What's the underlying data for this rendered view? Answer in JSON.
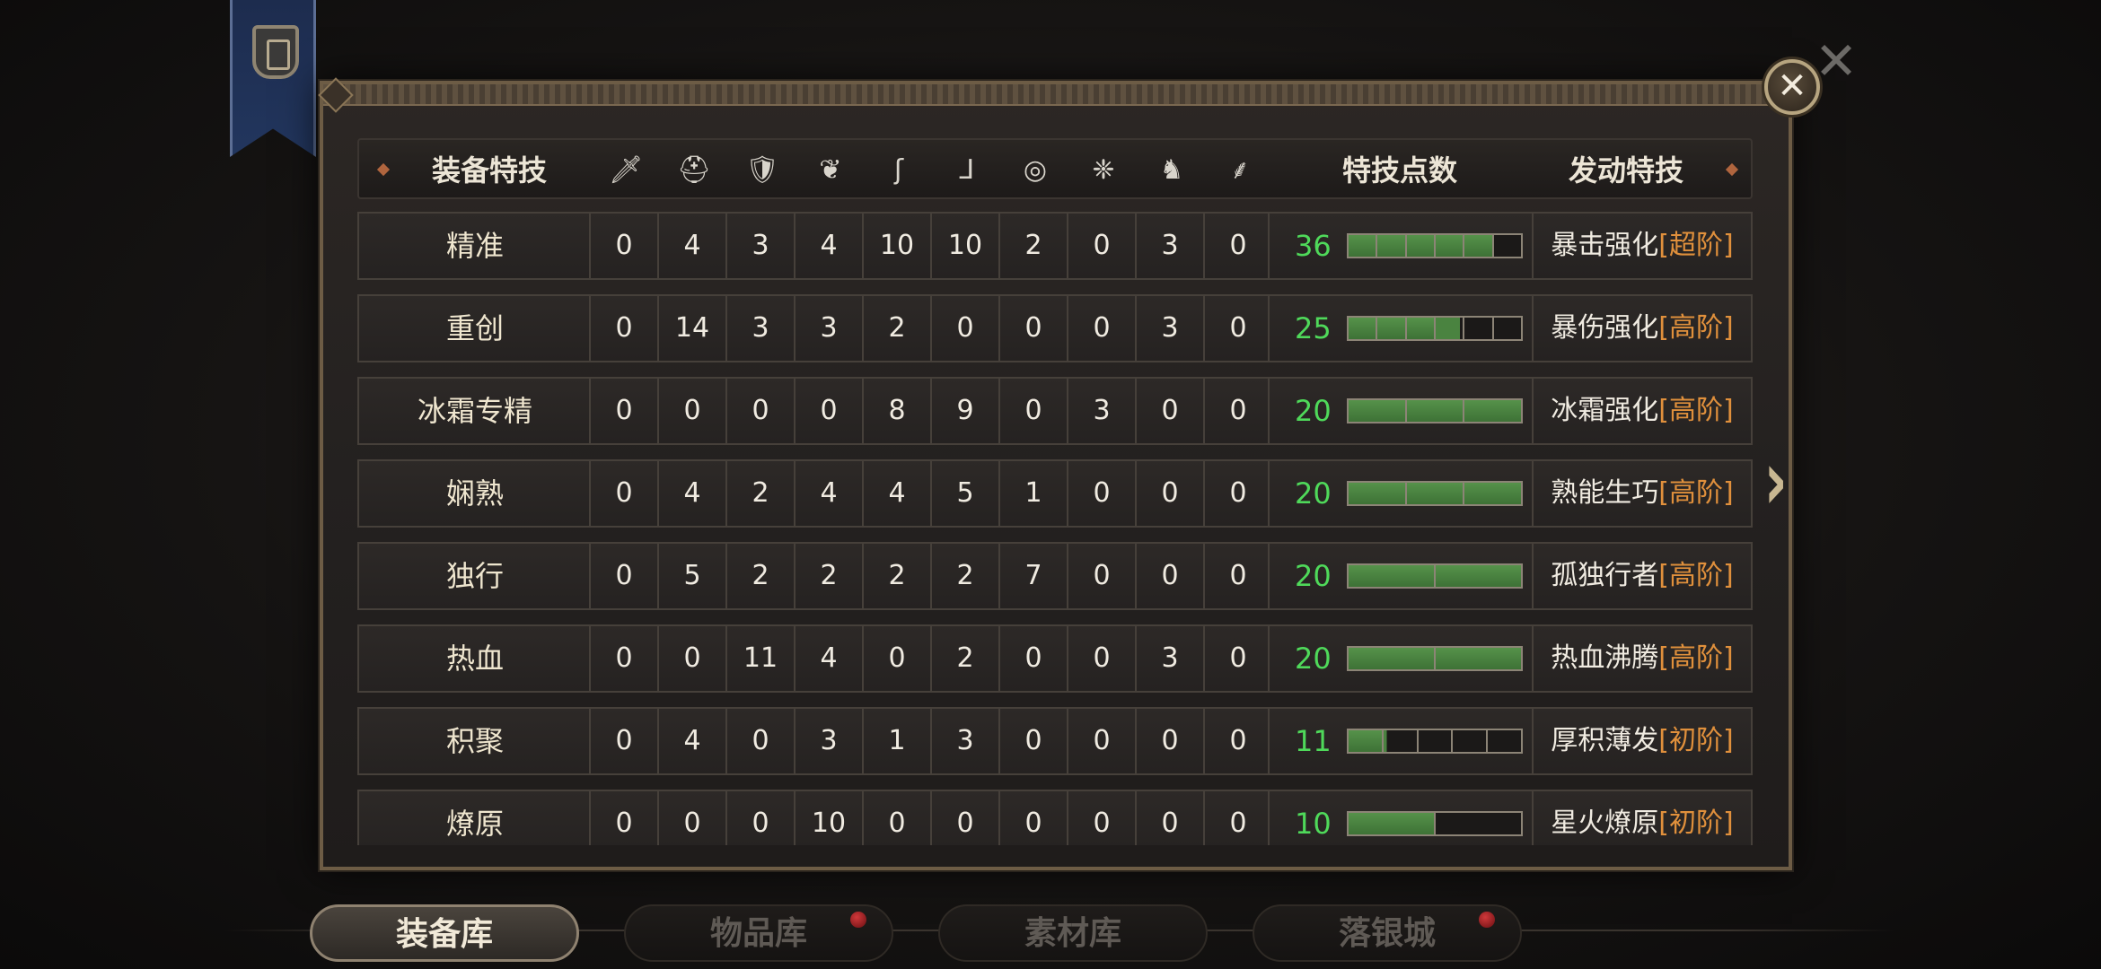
{
  "header": {
    "title": "装备特技",
    "slot_icons": [
      "sword-icon",
      "helmet-icon",
      "armor-icon",
      "shoulder-icon",
      "bracer-icon",
      "boots-icon",
      "ring-icon",
      "emblem-icon",
      "horse-icon",
      "pendant-icon"
    ],
    "points_label": "特技点数",
    "skill_label": "发动特技"
  },
  "rows": [
    {
      "name": "精准",
      "values": [
        "0",
        "4",
        "3",
        "4",
        "10",
        "10",
        "2",
        "0",
        "3",
        "0"
      ],
      "points": "36",
      "segments": 6,
      "filled": 5,
      "skill": "暴击强化",
      "tier": "[超阶]"
    },
    {
      "name": "重创",
      "values": [
        "0",
        "14",
        "3",
        "3",
        "2",
        "0",
        "0",
        "0",
        "3",
        "0"
      ],
      "points": "25",
      "segments": 6,
      "filled": 3.9,
      "skill": "暴伤强化",
      "tier": "[高阶]"
    },
    {
      "name": "冰霜专精",
      "values": [
        "0",
        "0",
        "0",
        "0",
        "8",
        "9",
        "0",
        "3",
        "0",
        "0"
      ],
      "points": "20",
      "segments": 3,
      "filled": 3,
      "skill": "冰霜强化",
      "tier": "[高阶]"
    },
    {
      "name": "娴熟",
      "values": [
        "0",
        "4",
        "2",
        "4",
        "4",
        "5",
        "1",
        "0",
        "0",
        "0"
      ],
      "points": "20",
      "segments": 3,
      "filled": 3,
      "skill": "熟能生巧",
      "tier": "[高阶]"
    },
    {
      "name": "独行",
      "values": [
        "0",
        "5",
        "2",
        "2",
        "2",
        "2",
        "7",
        "0",
        "0",
        "0"
      ],
      "points": "20",
      "segments": 2,
      "filled": 2,
      "skill": "孤独行者",
      "tier": "[高阶]"
    },
    {
      "name": "热血",
      "values": [
        "0",
        "0",
        "11",
        "4",
        "0",
        "2",
        "0",
        "0",
        "3",
        "0"
      ],
      "points": "20",
      "segments": 2,
      "filled": 2,
      "skill": "热血沸腾",
      "tier": "[高阶]"
    },
    {
      "name": "积聚",
      "values": [
        "0",
        "4",
        "0",
        "3",
        "1",
        "3",
        "0",
        "0",
        "0",
        "0"
      ],
      "points": "11",
      "segments": 5,
      "filled": 1.1,
      "skill": "厚积薄发",
      "tier": "[初阶]"
    },
    {
      "name": "燎原",
      "values": [
        "0",
        "0",
        "0",
        "10",
        "0",
        "0",
        "0",
        "0",
        "0",
        "0"
      ],
      "points": "10",
      "segments": 2,
      "filled": 1,
      "skill": "星火燎原",
      "tier": "[初阶]"
    }
  ],
  "tabs": [
    {
      "label": "装备库",
      "active": true,
      "dot": false
    },
    {
      "label": "物品库",
      "active": false,
      "dot": true
    },
    {
      "label": "素材库",
      "active": false,
      "dot": false
    },
    {
      "label": "落银城",
      "active": false,
      "dot": true
    }
  ],
  "controls": {
    "close_glyph": "✕",
    "outer_close_glyph": "✕",
    "next_glyph": "›"
  },
  "colors": {
    "points_green": "#4fd95a",
    "tier_orange": "#e0903c",
    "bar_fill": "#4a8340"
  }
}
